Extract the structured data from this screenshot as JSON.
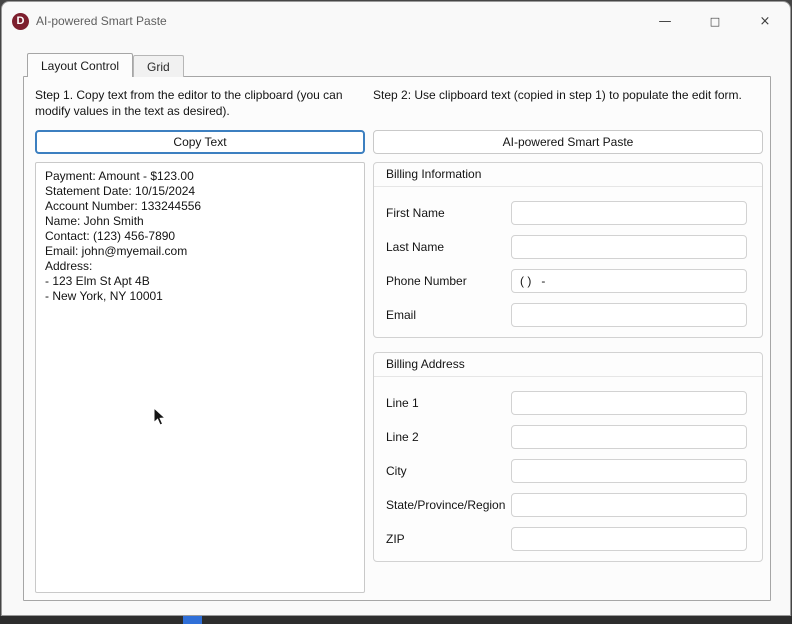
{
  "window": {
    "title": "AI-powered Smart Paste",
    "icon_letter": "D",
    "controls": {
      "minimize": "—",
      "maximize": "□",
      "close": "×"
    }
  },
  "tabs": {
    "layout_control": "Layout Control",
    "grid": "Grid"
  },
  "step1": {
    "instruction": "Step 1. Copy text from the editor to the clipboard (you can modify values in the text as desired).",
    "copy_button_label": "Copy Text",
    "editor_lines": [
      "Payment: Amount - $123.00",
      "Statement Date: 10/15/2024",
      "Account Number: 133244556",
      "Name: John Smith",
      "Contact: (123) 456-7890",
      "Email: john@myemail.com",
      "Address:",
      "- 123 Elm St Apt 4B",
      "- New York, NY 10001"
    ]
  },
  "step2": {
    "instruction": "Step 2: Use clipboard text (copied in step 1) to populate the edit form.",
    "paste_button_label": "AI-powered Smart Paste",
    "billing_information": {
      "title": "Billing Information",
      "fields": [
        {
          "label": "First Name",
          "value": ""
        },
        {
          "label": "Last Name",
          "value": ""
        },
        {
          "label": "Phone Number",
          "value": "( )   -"
        },
        {
          "label": "Email",
          "value": ""
        }
      ]
    },
    "billing_address": {
      "title": "Billing Address",
      "fields": [
        {
          "label": "Line 1",
          "value": ""
        },
        {
          "label": "Line 2",
          "value": ""
        },
        {
          "label": "City",
          "value": ""
        },
        {
          "label": "State/Province/Region",
          "value": ""
        },
        {
          "label": "ZIP",
          "value": ""
        }
      ]
    }
  },
  "colors": {
    "brand_red": "#7d1f2e",
    "focus_blue": "#3c7fc0",
    "taskbar_accent_blue": "#2f6fd8"
  }
}
